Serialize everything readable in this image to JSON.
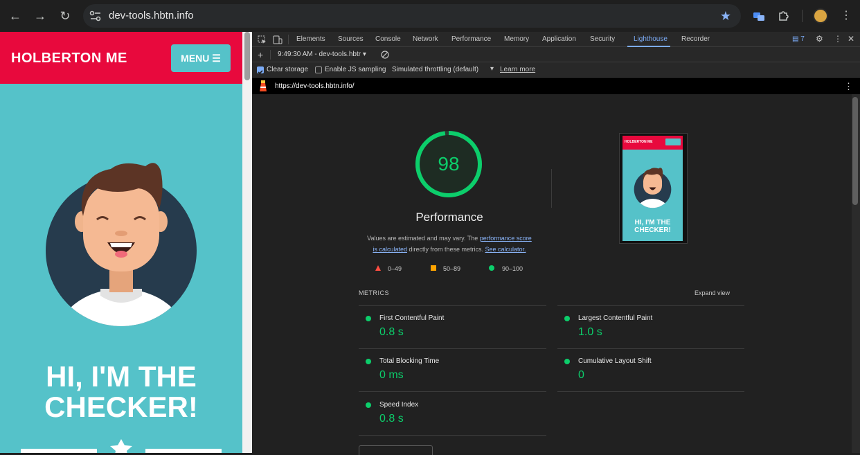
{
  "browser": {
    "url": "dev-tools.hbtn.info",
    "back_glyph": "←",
    "forward_glyph": "→",
    "reload_glyph": "↻",
    "bookmark_glyph": "★",
    "menu_glyph": "⋮"
  },
  "site": {
    "brand": "HOLBERTON ME",
    "menu_label": "MENU ☰",
    "hero_line1": "HI, I'M THE",
    "hero_line2": "CHECKER!"
  },
  "devtools": {
    "tabs": [
      "Elements",
      "Sources",
      "Console",
      "Network",
      "Performance",
      "Memory",
      "Application",
      "Security",
      "Lighthouse",
      "Recorder"
    ],
    "active_tab": "Lighthouse",
    "issues_count": "7",
    "report_time": "9:49:30 AM - dev-tools.hbtr",
    "clear_storage": "Clear storage",
    "enable_js_sampling": "Enable JS sampling",
    "throttling": "Simulated throttling (default)",
    "learn_more": "Learn more",
    "report_url": "https://dev-tools.hbtn.info/"
  },
  "lighthouse": {
    "score": "98",
    "score_value": 98,
    "category": "Performance",
    "desc_pre": "Values are estimated and may vary. The ",
    "desc_link1a": "performance score",
    "desc_link1b": "is calculated",
    "desc_mid": " directly from these metrics. ",
    "desc_link2": "See calculator.",
    "legend": [
      {
        "range": "0–49",
        "color": "#ff4e42"
      },
      {
        "range": "50–89",
        "color": "#ffa400"
      },
      {
        "range": "90–100",
        "color": "#0cce6b"
      }
    ],
    "metrics_title": "METRICS",
    "expand_view": "Expand view",
    "metrics": [
      {
        "label": "First Contentful Paint",
        "value": "0.8 s"
      },
      {
        "label": "Largest Contentful Paint",
        "value": "1.0 s"
      },
      {
        "label": "Total Blocking Time",
        "value": "0 ms"
      },
      {
        "label": "Cumulative Layout Shift",
        "value": "0"
      },
      {
        "label": "Speed Index",
        "value": "0.8 s"
      }
    ],
    "thumb": {
      "brand": "HOLBERTON ME",
      "line1": "HI, I'M THE",
      "line2": "CHECKER!"
    }
  },
  "colors": {
    "site_red": "#e8093d",
    "site_teal": "#55c2c9",
    "pass_green": "#0cce6b",
    "link_blue": "#8ab4f8"
  }
}
